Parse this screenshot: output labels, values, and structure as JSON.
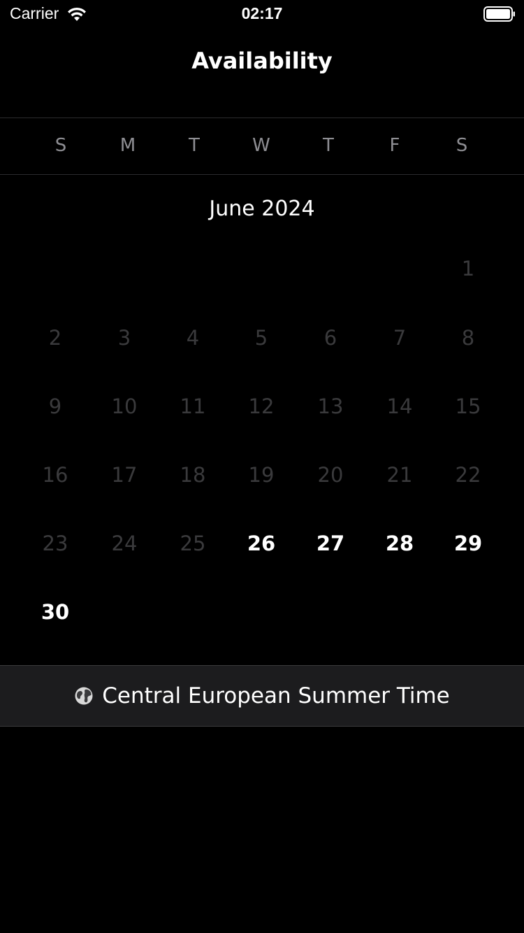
{
  "status_bar": {
    "carrier": "Carrier",
    "time": "02:17",
    "icons": [
      "wifi-icon",
      "battery-icon"
    ]
  },
  "nav": {
    "title": "Availability"
  },
  "weekdays": [
    "S",
    "M",
    "T",
    "W",
    "T",
    "F",
    "S"
  ],
  "calendar": {
    "month": "June 2024",
    "selected_day": "26",
    "available_days": [
      "27",
      "28",
      "29",
      "30"
    ],
    "days": [
      "1",
      "2",
      "3",
      "4",
      "5",
      "6",
      "7",
      "8",
      "9",
      "10",
      "11",
      "12",
      "13",
      "14",
      "15",
      "16",
      "17",
      "18",
      "19",
      "20",
      "21",
      "22",
      "23",
      "24",
      "25",
      "26",
      "27",
      "28",
      "29",
      "30"
    ]
  },
  "timezone": {
    "icon": "globe-icon",
    "label": "Central European Summer Time"
  },
  "colors": {
    "background": "#000000",
    "selected_day": "#ff5a5f",
    "unavailable_day": "#3a3a3c",
    "timezone_bar": "#1c1c1e"
  }
}
